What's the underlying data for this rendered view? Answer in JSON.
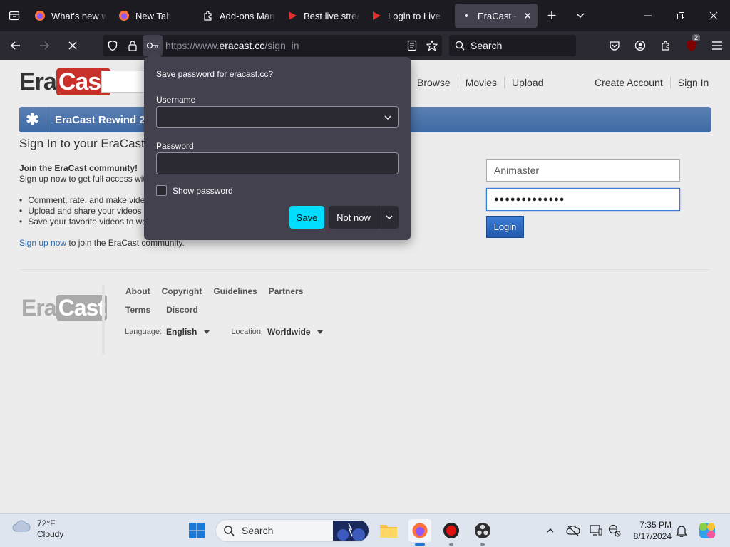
{
  "browser": {
    "tabs": [
      {
        "title": "What's new with",
        "icon": "firefox-icon"
      },
      {
        "title": "New Tab",
        "icon": "firefox-icon"
      },
      {
        "title": "Add-ons Manager",
        "icon": "puzzle-icon"
      },
      {
        "title": "Best live stream",
        "icon": "eracast-icon"
      },
      {
        "title": "Login to Live Str",
        "icon": "eracast-icon"
      },
      {
        "title": "EraCast - Sign",
        "icon": "loading-dot-icon",
        "active": true
      }
    ],
    "url_prefix": "https://www.",
    "url_domain": "eracast.cc",
    "url_path": "/sign_in",
    "search_placeholder": "Search",
    "extension_badge": "2"
  },
  "site": {
    "logo_era": "Era",
    "logo_cast": "Cast",
    "nav": [
      "Browse",
      "Movies",
      "Upload"
    ],
    "create_account": "Create Account",
    "sign_in": "Sign In",
    "banner_text": "EraCast Rewind 2024",
    "page_title": "Sign In to your EraCast account",
    "join_heading": "Join the EraCast community!",
    "join_sub": "Sign up now to get full access with your EraCast account:",
    "bullets": [
      "Comment, rate, and make video responses to your favorite videos",
      "Upload and share your videos with millions of other users",
      "Save your favorite videos to watch and share later"
    ],
    "signup_link": "Sign up now",
    "signup_rest": " to join the EraCast community.",
    "username_value": "Animaster",
    "password_value": "●●●●●●●●●●●●●",
    "login_button": "Login",
    "footer_links_row1": [
      "About",
      "Copyright",
      "Guidelines",
      "Partners"
    ],
    "footer_links_row2": [
      "Terms",
      "Discord"
    ],
    "language_label": "Language:",
    "language_value": "English",
    "location_label": "Location:",
    "location_value": "Worldwide"
  },
  "password_popup": {
    "title": "Save password for eracast.cc?",
    "username_label": "Username",
    "username_value": "",
    "password_label": "Password",
    "password_value": "",
    "show_password_label": "Show password",
    "show_password_checked": false,
    "save_button": "Save",
    "not_now_button": "Not now"
  },
  "taskbar": {
    "temperature": "72°F",
    "condition": "Cloudy",
    "search_placeholder": "Search",
    "time": "7:35 PM",
    "date": "8/17/2024"
  },
  "colors": {
    "accent_cyan": "#00ddff",
    "brand_red": "#c8312a",
    "banner_blue": "#4a74ad",
    "link_blue": "#2d6db5"
  }
}
